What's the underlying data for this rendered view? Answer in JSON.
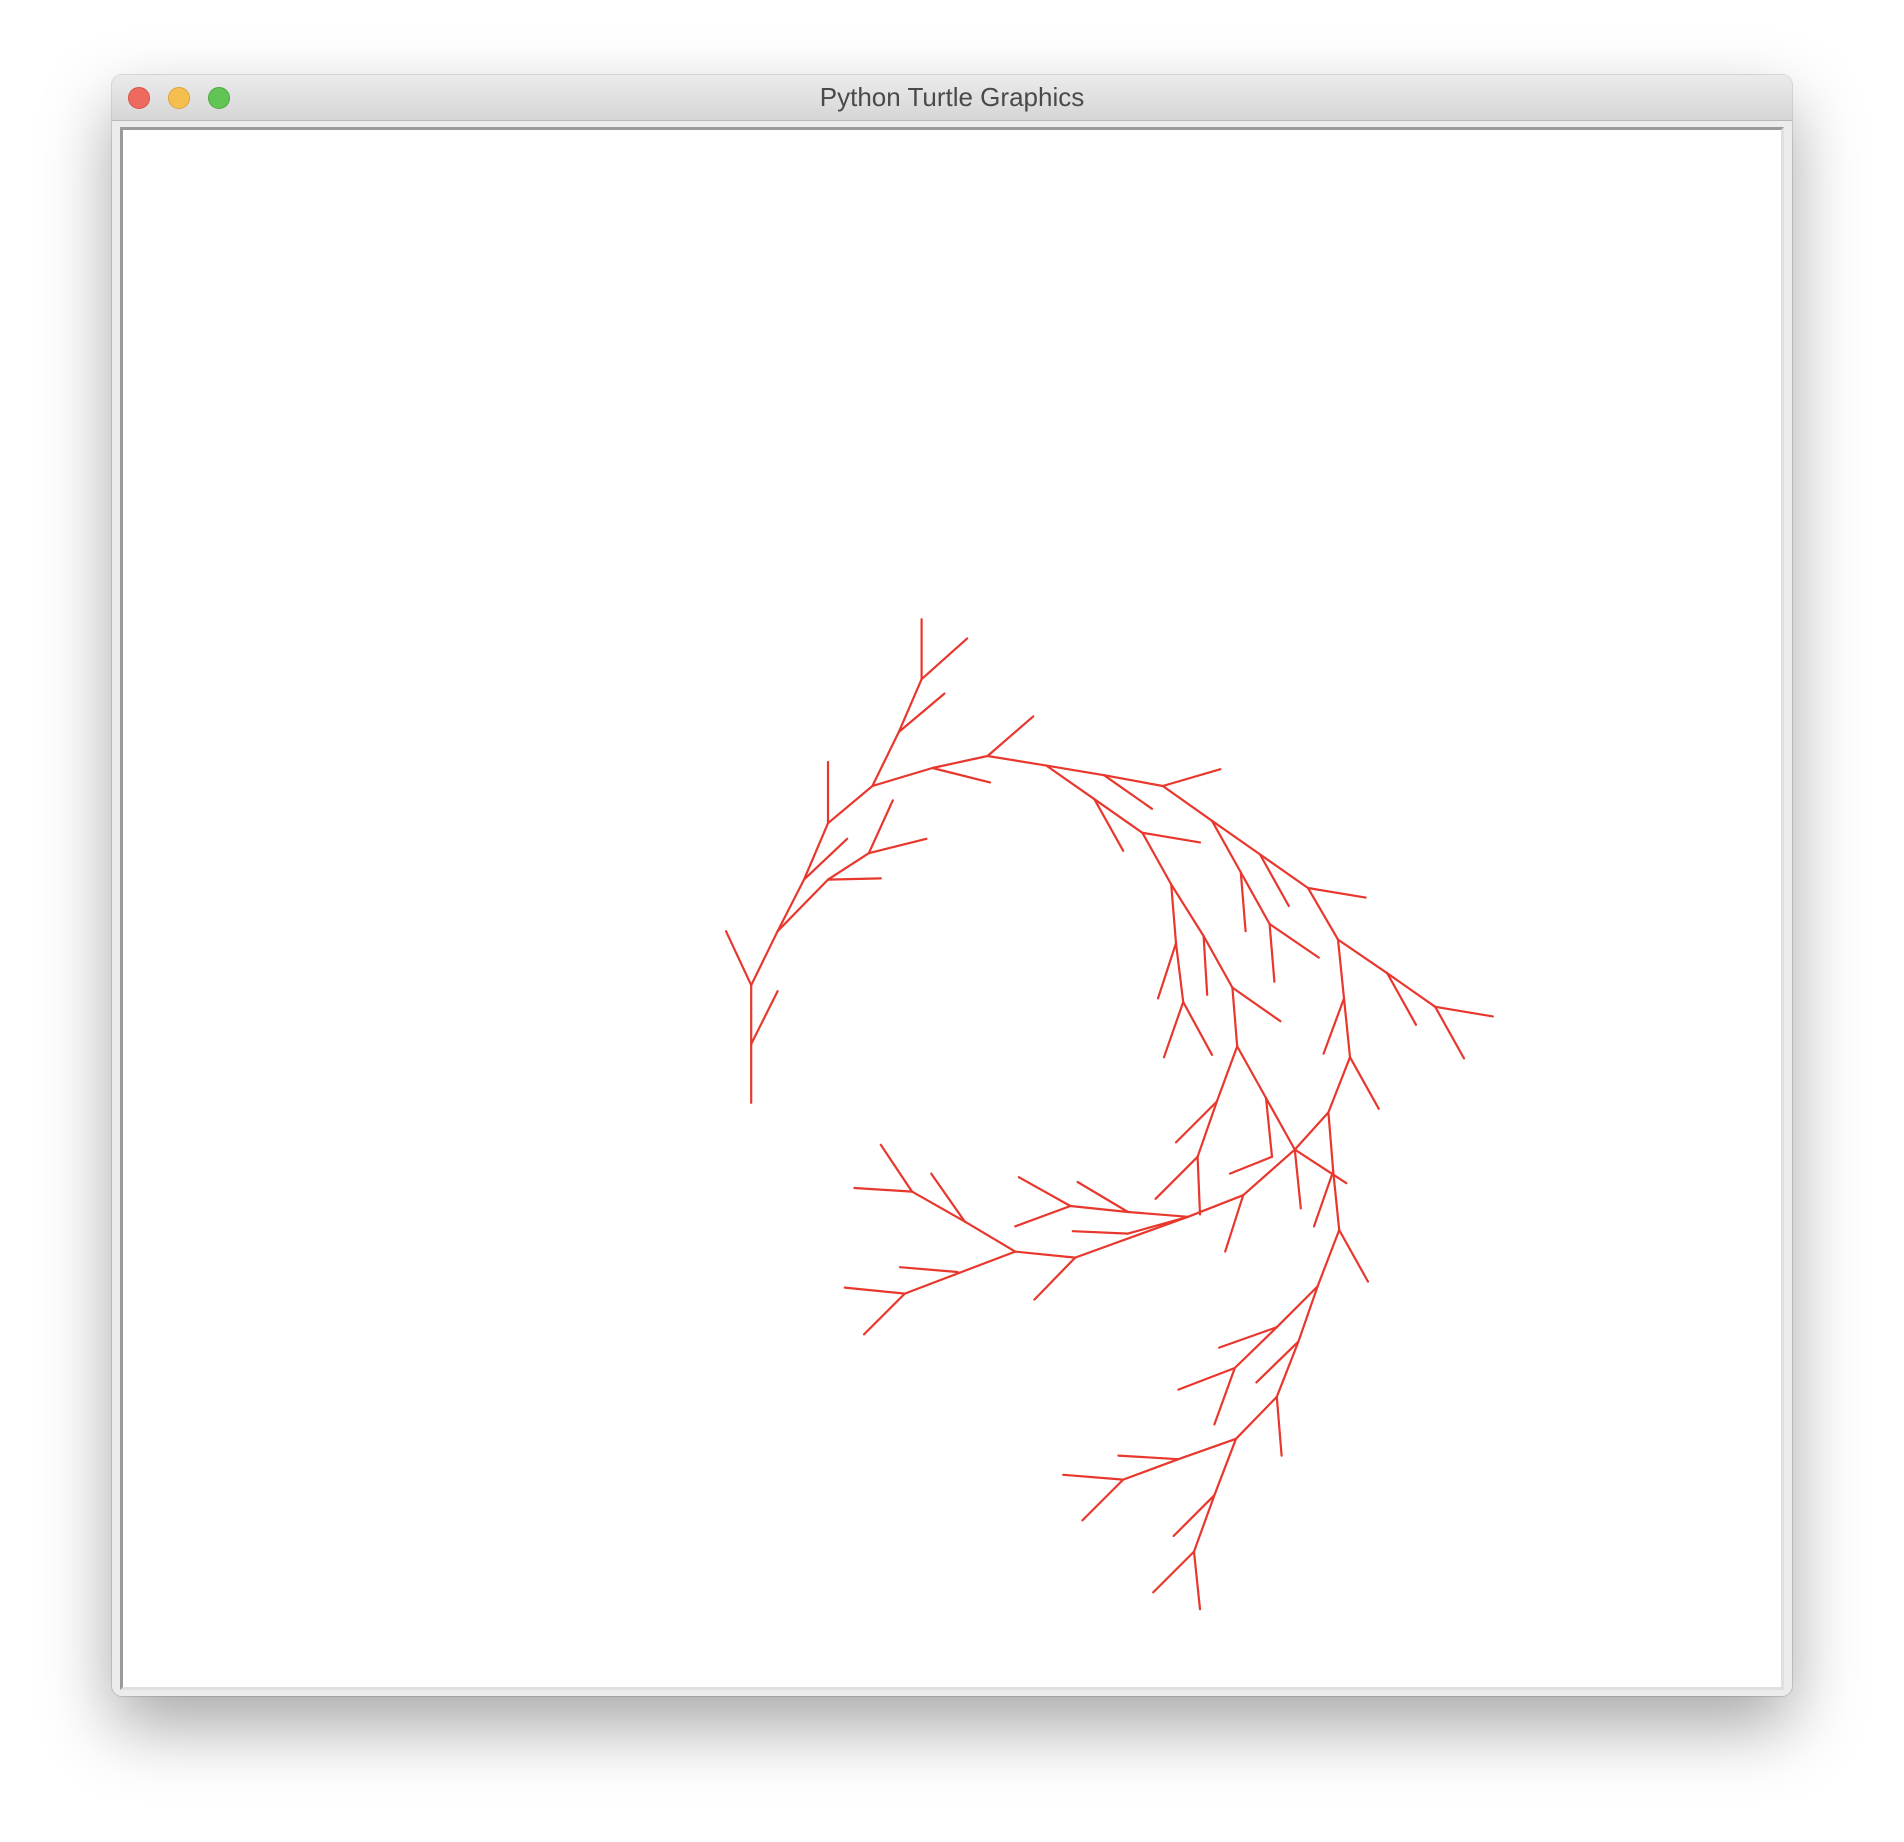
{
  "window": {
    "title": "Python Turtle Graphics"
  },
  "controls": {
    "close": "close-button",
    "minimize": "minimize-button",
    "zoom": "zoom-button"
  },
  "colors": {
    "stroke": "#e8372d",
    "close": "#ee6a5e",
    "minimize": "#f5bf4f",
    "zoom": "#61c454"
  },
  "drawing": {
    "description": "fractal tree branches",
    "segment_count": 100
  }
}
